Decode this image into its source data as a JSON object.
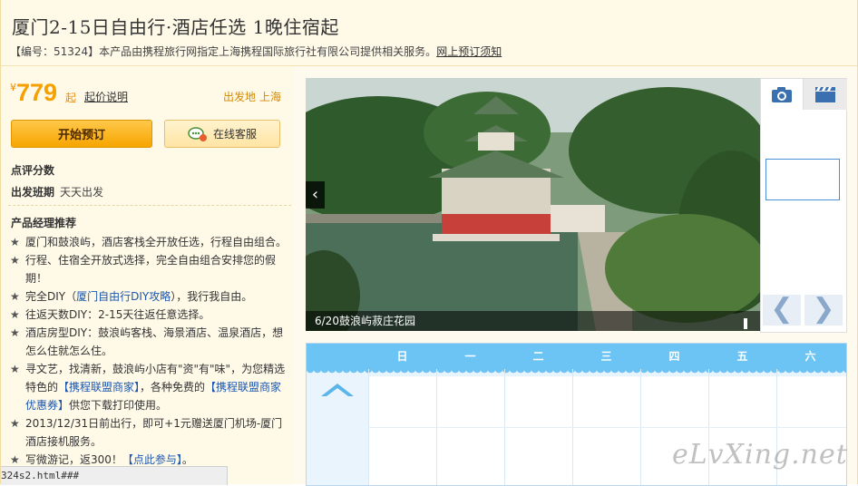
{
  "header": {
    "title": "厦门2-15日自由行·酒店任选 1晚住宿起",
    "subtitle_prefix": "【编号：51324】本产品由携程旅行网指定上海携程国际旅行社有限公司提供相关服务。",
    "subtitle_link": "网上预订须知"
  },
  "pricing": {
    "currency": "¥",
    "amount": "779",
    "suffix": "起",
    "explain_link": "起价说明",
    "departure_label": "出发地",
    "departure_city": "上海"
  },
  "buttons": {
    "book": "开始预订",
    "service": "在线客服"
  },
  "info": {
    "rating_label": "点评分数",
    "period_label": "出发班期",
    "period_value": "天天出发"
  },
  "recommendations": {
    "title": "产品经理推荐",
    "items": [
      {
        "text": "厦门和鼓浪屿，酒店客栈全开放任选，行程自由组合。"
      },
      {
        "text": "行程、住宿全开放式选择，完全自由组合安排您的假期！"
      },
      {
        "before": "完全DIY（",
        "link": "厦门自由行DIY攻略",
        "after": "），我行我自由。"
      },
      {
        "text": "往返天数DIY：2-15天往返任意选择。"
      },
      {
        "text": "酒店房型DIY：鼓浪屿客栈、海景酒店、温泉酒店，想怎么住就怎么住。"
      },
      {
        "before": "寻文艺，找清新，鼓浪屿小店有\"资\"有\"味\"，为您精选特色的",
        "link": "【携程联盟商家】",
        "middle": "，各种免费的",
        "link2": "【携程联盟商家优惠券】",
        "after": "供您下载打印使用。"
      },
      {
        "text": "2013/12/31日前出行，即可+1元赠送厦门机场-厦门酒店接机服务。"
      },
      {
        "before": "写微游记，返300！",
        "link": "【点此参与】",
        "after": "。"
      }
    ]
  },
  "status_bar": "324s2.html###",
  "gallery": {
    "caption": "6/20鼓浪屿菽庄花园",
    "prev_thumb": "❮",
    "next_thumb": "❯",
    "prev_main": "‹"
  },
  "calendar": {
    "days": [
      "日",
      "一",
      "二",
      "三",
      "四",
      "五",
      "六"
    ]
  },
  "watermark": "eLvXing.net",
  "colors": {
    "accent": "#f5a000",
    "calendar_header": "#6cc4f5",
    "link": "#1a56b0"
  }
}
